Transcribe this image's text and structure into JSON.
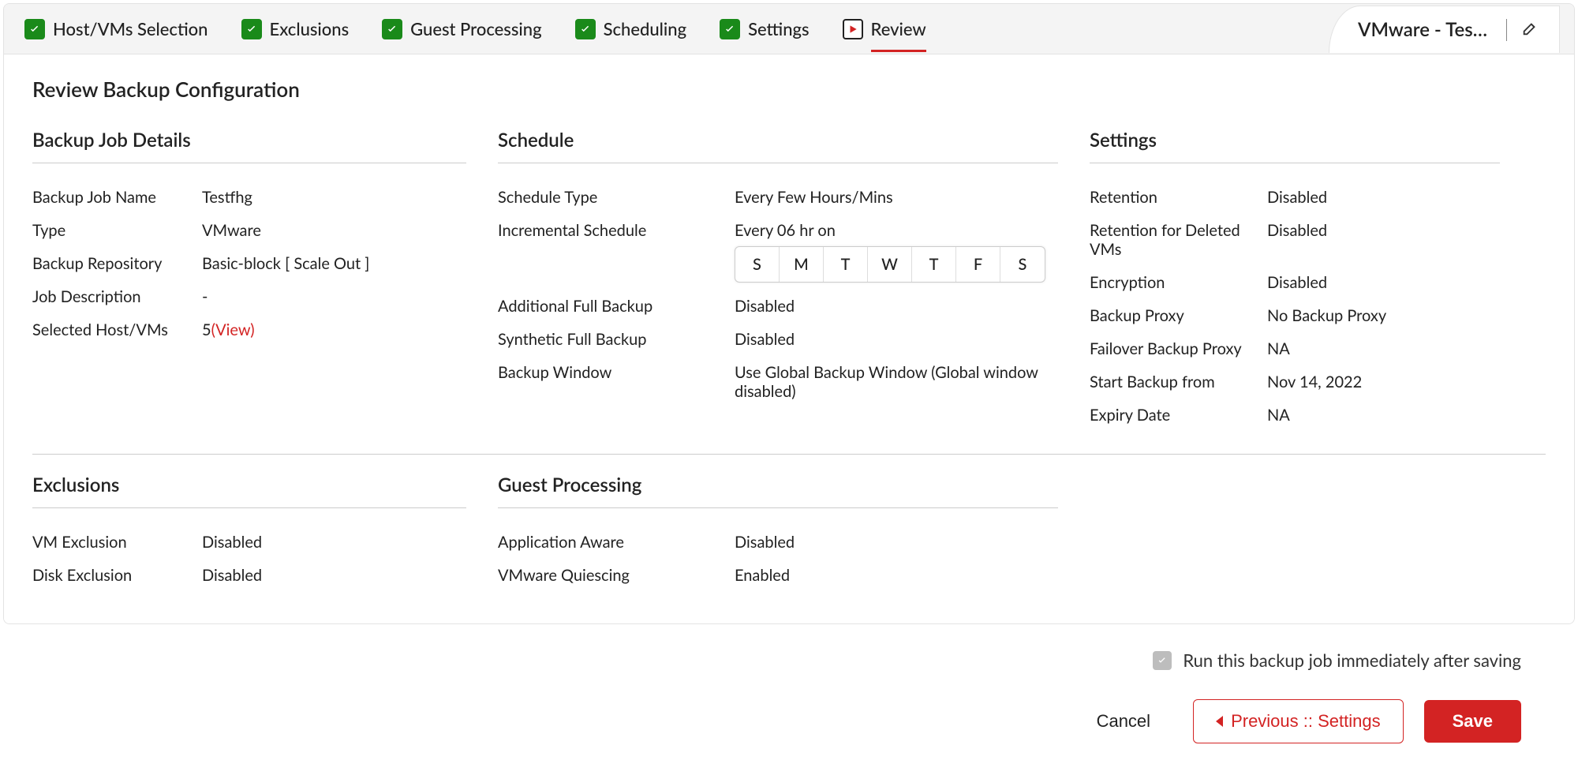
{
  "header": {
    "steps": [
      {
        "label": "Host/VMs Selection",
        "state": "done"
      },
      {
        "label": "Exclusions",
        "state": "done"
      },
      {
        "label": "Guest Processing",
        "state": "done"
      },
      {
        "label": "Scheduling",
        "state": "done"
      },
      {
        "label": "Settings",
        "state": "done"
      },
      {
        "label": "Review",
        "state": "active"
      }
    ],
    "title": "VMware - Testf..."
  },
  "page_title": "Review Backup Configuration",
  "backup_job_details": {
    "title": "Backup Job Details",
    "rows": {
      "name_label": "Backup Job Name",
      "name_value": "Testfhg",
      "type_label": "Type",
      "type_value": "VMware",
      "repo_label": "Backup Repository",
      "repo_value": "Basic-block [ Scale Out ]",
      "desc_label": "Job Description",
      "desc_value": "-",
      "selected_label": "Selected Host/VMs",
      "selected_count": "5",
      "selected_view": "(View)"
    }
  },
  "schedule": {
    "title": "Schedule",
    "rows": {
      "type_label": "Schedule Type",
      "type_value": "Every Few Hours/Mins",
      "incr_label": "Incremental Schedule",
      "incr_value": "Every 06 hr on",
      "days": [
        "S",
        "M",
        "T",
        "W",
        "T",
        "F",
        "S"
      ],
      "addfull_label": "Additional Full Backup",
      "addfull_value": "Disabled",
      "synth_label": "Synthetic Full Backup",
      "synth_value": "Disabled",
      "window_label": "Backup Window",
      "window_value": "Use Global Backup Window  (Global window disabled)"
    }
  },
  "settings": {
    "title": "Settings",
    "rows": {
      "retention_label": "Retention",
      "retention_value": "Disabled",
      "retdel_label": "Retention for Deleted VMs",
      "retdel_value": "Disabled",
      "encryption_label": "Encryption",
      "encryption_value": "Disabled",
      "proxy_label": "Backup Proxy",
      "proxy_value": "No Backup Proxy",
      "failover_label": "Failover Backup Proxy",
      "failover_value": "NA",
      "start_label": "Start Backup from",
      "start_value": "Nov 14, 2022",
      "expiry_label": "Expiry Date",
      "expiry_value": "NA"
    }
  },
  "exclusions": {
    "title": "Exclusions",
    "rows": {
      "vm_label": "VM Exclusion",
      "vm_value": "Disabled",
      "disk_label": "Disk Exclusion",
      "disk_value": "Disabled"
    }
  },
  "guest": {
    "title": "Guest Processing",
    "rows": {
      "app_label": "Application Aware",
      "app_value": "Disabled",
      "quiesce_label": "VMware Quiescing",
      "quiesce_value": "Enabled"
    }
  },
  "footer": {
    "run_label": "Run this backup job immediately after saving",
    "cancel": "Cancel",
    "previous": "Previous :: Settings",
    "save": "Save"
  }
}
